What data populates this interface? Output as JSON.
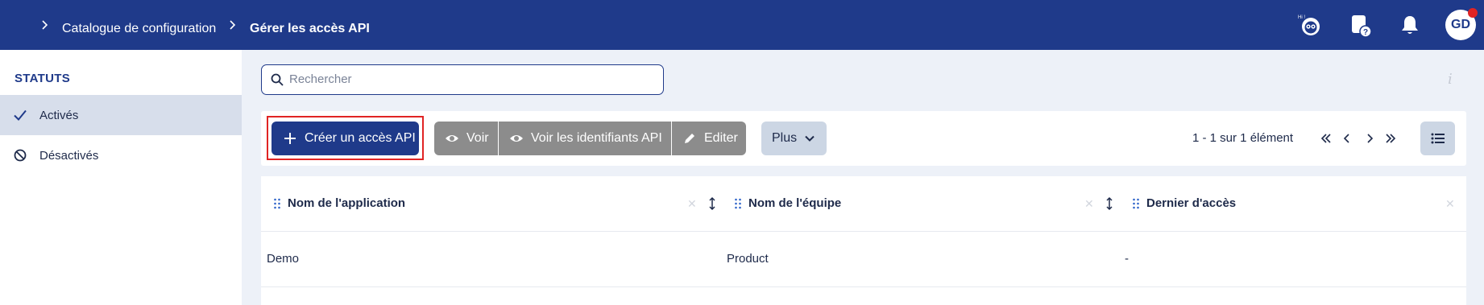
{
  "breadcrumb": {
    "items": [
      "Catalogue de configuration",
      "Gérer les accès API"
    ]
  },
  "header": {
    "avatar_initials": "GD",
    "help_badge": "?",
    "hi_label": "Hi !"
  },
  "sidebar": {
    "title": "STATUTS",
    "items": [
      {
        "label": "Activés",
        "icon": "check-icon",
        "active": true
      },
      {
        "label": "Désactivés",
        "icon": "ban-icon",
        "active": false
      }
    ]
  },
  "search": {
    "placeholder": "Rechercher",
    "value": ""
  },
  "info": "i",
  "toolbar": {
    "create_label": "Créer un accès API",
    "view_label": "Voir",
    "view_ids_label": "Voir les identifiants API",
    "edit_label": "Editer",
    "more_label": "Plus"
  },
  "pagination": {
    "text": "1 - 1 sur 1 élément"
  },
  "table": {
    "columns": [
      "Nom de l'application",
      "Nom de l'équipe",
      "Dernier d'accès"
    ],
    "rows": [
      [
        "Demo",
        "Product",
        "-"
      ]
    ]
  },
  "colors": {
    "primary": "#1f3a8a",
    "highlight": "#e02424",
    "grey_button": "#8c8c8c"
  }
}
